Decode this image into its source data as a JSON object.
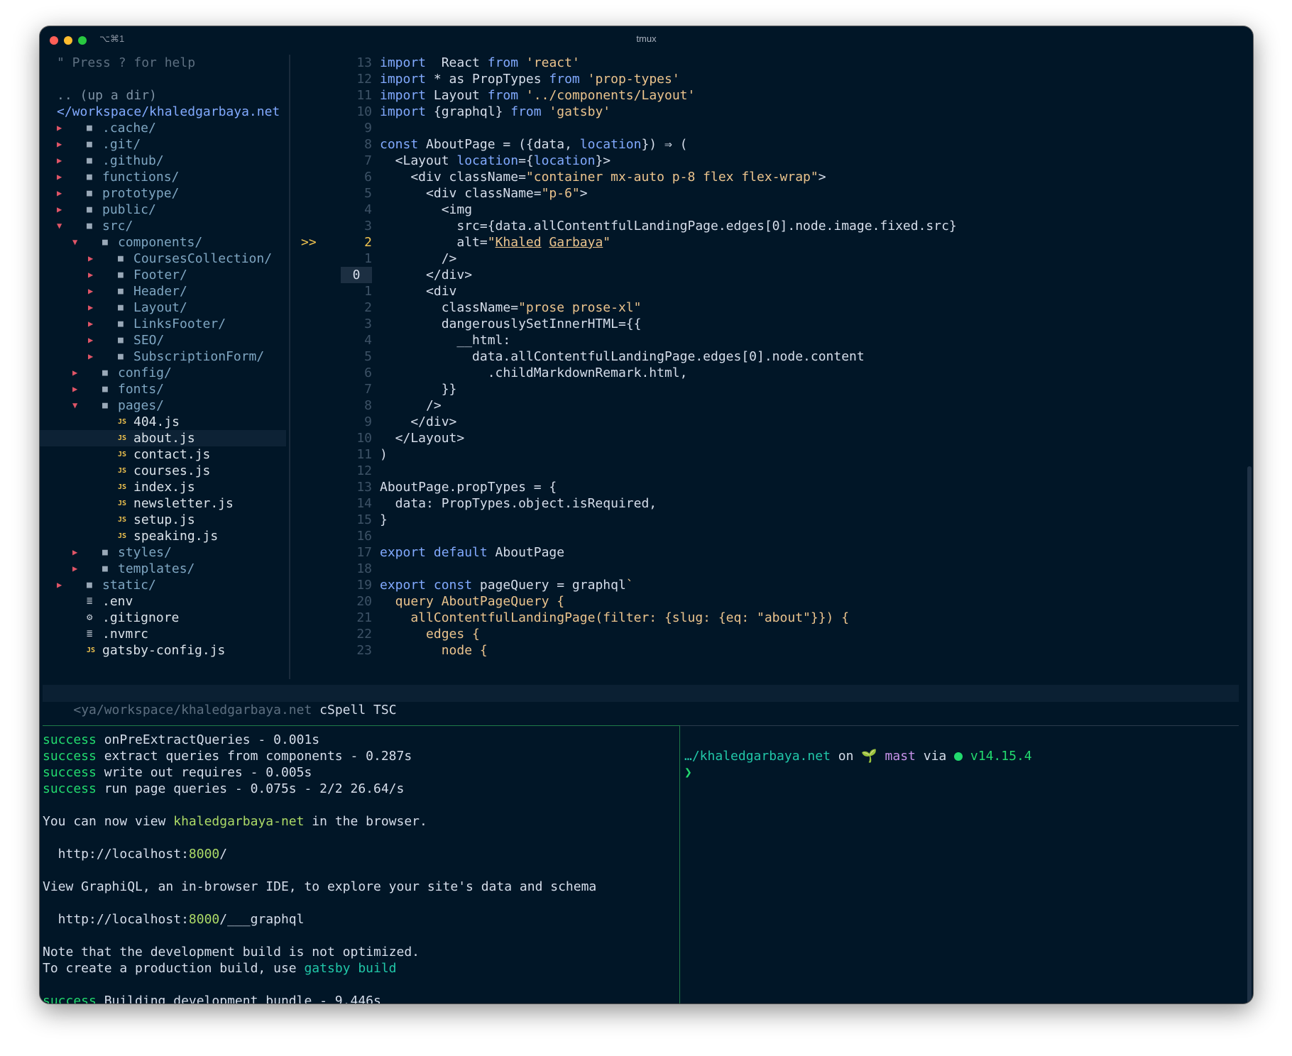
{
  "window": {
    "title": "tmux",
    "shortcut": "⌥⌘1"
  },
  "tree": {
    "help": "\" Press ? for help",
    "parent": ".. (up a dir)",
    "root": "</workspace/khaledgarbaya.net",
    "items": [
      {
        "name": ".cache/",
        "depth": 0,
        "kind": "dir",
        "open": false
      },
      {
        "name": ".git/",
        "depth": 0,
        "kind": "dir",
        "open": false
      },
      {
        "name": ".github/",
        "depth": 0,
        "kind": "dir",
        "open": false
      },
      {
        "name": "functions/",
        "depth": 0,
        "kind": "dir",
        "open": false
      },
      {
        "name": "prototype/",
        "depth": 0,
        "kind": "dir",
        "open": false
      },
      {
        "name": "public/",
        "depth": 0,
        "kind": "dir",
        "open": false
      },
      {
        "name": "src/",
        "depth": 0,
        "kind": "dir",
        "open": true
      },
      {
        "name": "components/",
        "depth": 1,
        "kind": "dir",
        "open": true
      },
      {
        "name": "CoursesCollection/",
        "depth": 2,
        "kind": "dir",
        "open": false
      },
      {
        "name": "Footer/",
        "depth": 2,
        "kind": "dir",
        "open": false
      },
      {
        "name": "Header/",
        "depth": 2,
        "kind": "dir",
        "open": false
      },
      {
        "name": "Layout/",
        "depth": 2,
        "kind": "dir",
        "open": false
      },
      {
        "name": "LinksFooter/",
        "depth": 2,
        "kind": "dir",
        "open": false
      },
      {
        "name": "SEO/",
        "depth": 2,
        "kind": "dir",
        "open": false
      },
      {
        "name": "SubscriptionForm/",
        "depth": 2,
        "kind": "dir",
        "open": false
      },
      {
        "name": "config/",
        "depth": 1,
        "kind": "dir",
        "open": false
      },
      {
        "name": "fonts/",
        "depth": 1,
        "kind": "dir",
        "open": false
      },
      {
        "name": "pages/",
        "depth": 1,
        "kind": "dir",
        "open": true
      },
      {
        "name": "404.js",
        "depth": 2,
        "kind": "js"
      },
      {
        "name": "about.js",
        "depth": 2,
        "kind": "js",
        "selected": true
      },
      {
        "name": "contact.js",
        "depth": 2,
        "kind": "js"
      },
      {
        "name": "courses.js",
        "depth": 2,
        "kind": "js"
      },
      {
        "name": "index.js",
        "depth": 2,
        "kind": "js"
      },
      {
        "name": "newsletter.js",
        "depth": 2,
        "kind": "js"
      },
      {
        "name": "setup.js",
        "depth": 2,
        "kind": "js"
      },
      {
        "name": "speaking.js",
        "depth": 2,
        "kind": "js"
      },
      {
        "name": "styles/",
        "depth": 1,
        "kind": "dir",
        "open": false
      },
      {
        "name": "templates/",
        "depth": 1,
        "kind": "dir",
        "open": false
      },
      {
        "name": "static/",
        "depth": 0,
        "kind": "dir",
        "open": false
      },
      {
        "name": ".env",
        "depth": 0,
        "kind": "text"
      },
      {
        "name": ".gitignore",
        "depth": 0,
        "kind": "gear"
      },
      {
        "name": ".nvmrc",
        "depth": 0,
        "kind": "text"
      },
      {
        "name": "gatsby-config.js",
        "depth": 0,
        "kind": "js"
      }
    ]
  },
  "editor": {
    "current_marker": ">>",
    "lines": [
      {
        "n": "13",
        "t": [
          [
            "kw",
            "import"
          ],
          [
            "",
            "  React "
          ],
          [
            "kw",
            "from"
          ],
          [
            "s",
            " 'react'"
          ]
        ]
      },
      {
        "n": "12",
        "t": [
          [
            "kw",
            "import"
          ],
          [
            "",
            " * as PropTypes "
          ],
          [
            "kw",
            "from"
          ],
          [
            "s",
            " 'prop-types'"
          ]
        ]
      },
      {
        "n": "11",
        "t": [
          [
            "kw",
            "import"
          ],
          [
            "",
            " Layout "
          ],
          [
            "kw",
            "from"
          ],
          [
            "s",
            " '../components/Layout'"
          ]
        ]
      },
      {
        "n": "10",
        "t": [
          [
            "kw",
            "import"
          ],
          [
            "",
            " {graphql} "
          ],
          [
            "kw",
            "from"
          ],
          [
            "s",
            " 'gatsby'"
          ]
        ]
      },
      {
        "n": "9",
        "t": []
      },
      {
        "n": "8",
        "t": [
          [
            "kw",
            "const"
          ],
          [
            "",
            " AboutPage = ({data, "
          ],
          [
            "kw",
            "location"
          ],
          [
            "",
            "}) ⇒ ("
          ]
        ]
      },
      {
        "n": "7",
        "t": [
          [
            "",
            "  <Layout "
          ],
          [
            "kw",
            "location"
          ],
          [
            "",
            "={"
          ],
          [
            "kw",
            "location"
          ],
          [
            "",
            "}>"
          ]
        ]
      },
      {
        "n": "6",
        "t": [
          [
            "",
            "    <div className="
          ],
          [
            "s",
            "\"container mx-auto p-8 flex flex-wrap\""
          ],
          [
            "",
            ">"
          ]
        ]
      },
      {
        "n": "5",
        "t": [
          [
            "",
            "      <div className="
          ],
          [
            "s",
            "\"p-6\""
          ],
          [
            "",
            ">"
          ]
        ]
      },
      {
        "n": "4",
        "t": [
          [
            "",
            "        <img"
          ]
        ]
      },
      {
        "n": "3",
        "t": [
          [
            "",
            "          src={data.allContentfulLandingPage.edges[0].node.image.fixed.src}"
          ]
        ]
      },
      {
        "n": "2",
        "cur": true,
        "t": [
          [
            "",
            "          alt="
          ],
          [
            "s",
            "\""
          ],
          [
            "uln",
            "Khaled"
          ],
          [
            "s",
            " "
          ],
          [
            "uln",
            "Garbaya"
          ],
          [
            "s",
            "\""
          ]
        ]
      },
      {
        "n": "1",
        "t": [
          [
            "",
            "        />"
          ]
        ]
      },
      {
        "n": "0",
        "zero": true,
        "t": [
          [
            "",
            "      </div>"
          ]
        ]
      },
      {
        "n": "1",
        "t": [
          [
            "",
            "      <div"
          ]
        ]
      },
      {
        "n": "2",
        "t": [
          [
            "",
            "        className="
          ],
          [
            "s",
            "\"prose prose-xl\""
          ]
        ]
      },
      {
        "n": "3",
        "t": [
          [
            "",
            "        dangerouslySetInnerHTML={{"
          ]
        ]
      },
      {
        "n": "4",
        "t": [
          [
            "",
            "          __html:"
          ]
        ]
      },
      {
        "n": "5",
        "t": [
          [
            "",
            "            data.allContentfulLandingPage.edges[0].node.content"
          ]
        ]
      },
      {
        "n": "6",
        "t": [
          [
            "",
            "              .childMarkdownRemark.html,"
          ]
        ]
      },
      {
        "n": "7",
        "t": [
          [
            "",
            "        }}"
          ]
        ]
      },
      {
        "n": "8",
        "t": [
          [
            "",
            "      />"
          ]
        ]
      },
      {
        "n": "9",
        "t": [
          [
            "",
            "    </div>"
          ]
        ]
      },
      {
        "n": "10",
        "t": [
          [
            "",
            "  </Layout>"
          ]
        ]
      },
      {
        "n": "11",
        "t": [
          [
            "",
            ")"
          ]
        ]
      },
      {
        "n": "12",
        "t": []
      },
      {
        "n": "13",
        "t": [
          [
            "",
            "AboutPage.propTypes = {"
          ]
        ]
      },
      {
        "n": "14",
        "t": [
          [
            "",
            "  data: PropTypes.object.isRequired,"
          ]
        ]
      },
      {
        "n": "15",
        "t": [
          [
            "",
            "}"
          ]
        ]
      },
      {
        "n": "16",
        "t": []
      },
      {
        "n": "17",
        "t": [
          [
            "kw",
            "export default"
          ],
          [
            "",
            " AboutPage"
          ]
        ]
      },
      {
        "n": "18",
        "t": []
      },
      {
        "n": "19",
        "t": [
          [
            "kw",
            "export const"
          ],
          [
            "",
            " pageQuery = graphql"
          ],
          [
            "s",
            "`"
          ]
        ]
      },
      {
        "n": "20",
        "t": [
          [
            "s",
            "  query AboutPageQuery {"
          ]
        ]
      },
      {
        "n": "21",
        "t": [
          [
            "s",
            "    allContentfulLandingPage(filter: {slug: {eq: \"about\"}}) {"
          ]
        ]
      },
      {
        "n": "22",
        "t": [
          [
            "s",
            "      edges {"
          ]
        ]
      },
      {
        "n": "23",
        "t": [
          [
            "s",
            "        node {"
          ]
        ]
      }
    ]
  },
  "vim_status": {
    "path": "<ya/workspace/khaledgarbaya.net",
    "tags": "cSpell TSC"
  },
  "term_left": {
    "success_word": "success",
    "lines": [
      {
        "type": "success",
        "text": " onPreExtractQueries - 0.001s"
      },
      {
        "type": "success",
        "text": " extract queries from components - 0.287s"
      },
      {
        "type": "success",
        "text": " write out requires - 0.005s"
      },
      {
        "type": "success",
        "text": " run page queries - 0.075s - 2/2 26.64/s"
      },
      {
        "type": "blank"
      },
      {
        "type": "view",
        "pre": "You can now view ",
        "project": "khaledgarbaya-net",
        "post": " in the browser."
      },
      {
        "type": "blank"
      },
      {
        "type": "url",
        "pre": "  http://localhost:",
        "port": "8000",
        "post": "/"
      },
      {
        "type": "blank"
      },
      {
        "type": "plain",
        "text": "View GraphiQL, an in-browser IDE, to explore your site's data and schema"
      },
      {
        "type": "blank"
      },
      {
        "type": "url",
        "pre": "  http://localhost:",
        "port": "8000",
        "post": "/___graphql"
      },
      {
        "type": "blank"
      },
      {
        "type": "plain",
        "text": "Note that the development build is not optimized."
      },
      {
        "type": "build",
        "pre": "To create a production build, use ",
        "cmd": "gatsby build"
      },
      {
        "type": "blank"
      },
      {
        "type": "success",
        "text": " Building development bundle - 9.446s"
      }
    ]
  },
  "term_right": {
    "dir": "…/khaledgarbaya.net",
    "on": " on ",
    "branch_icon": "🌱",
    "branch": "mast",
    "via": " via ",
    "node_version": "v14.15.4",
    "prompt_char": "❯"
  }
}
